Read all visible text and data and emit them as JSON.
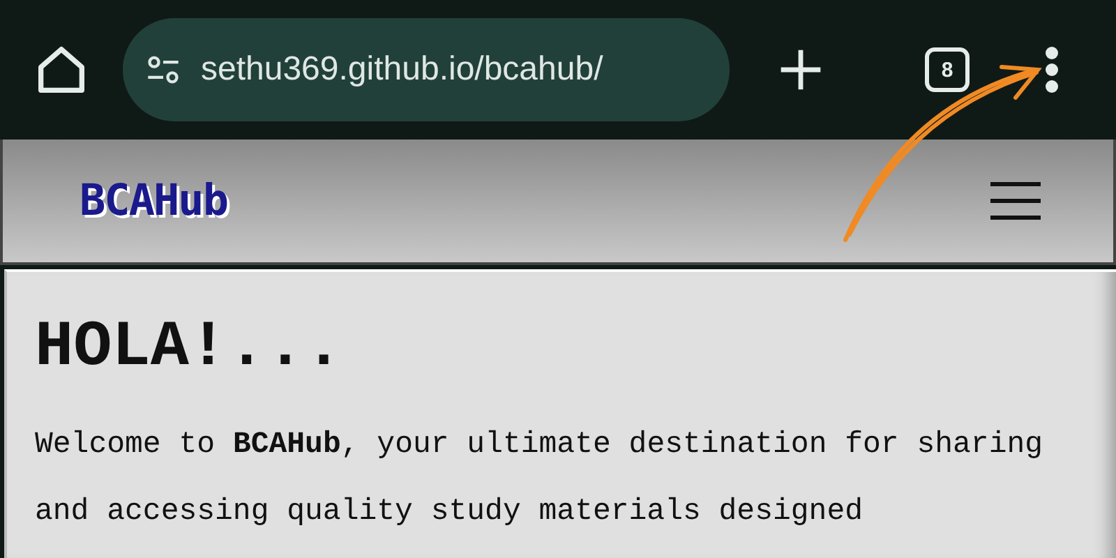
{
  "browser": {
    "url": "sethu369.github.io/bcahub/",
    "tab_count": "8"
  },
  "header": {
    "logo": "BCAHub"
  },
  "content": {
    "heading": "HOLA!...",
    "paragraph": "Welcome to **BCAHub**, your ultimate destination for sharing and accessing quality study materials designed"
  },
  "annotation": {
    "kind": "arrow",
    "color": "#f08a24"
  }
}
